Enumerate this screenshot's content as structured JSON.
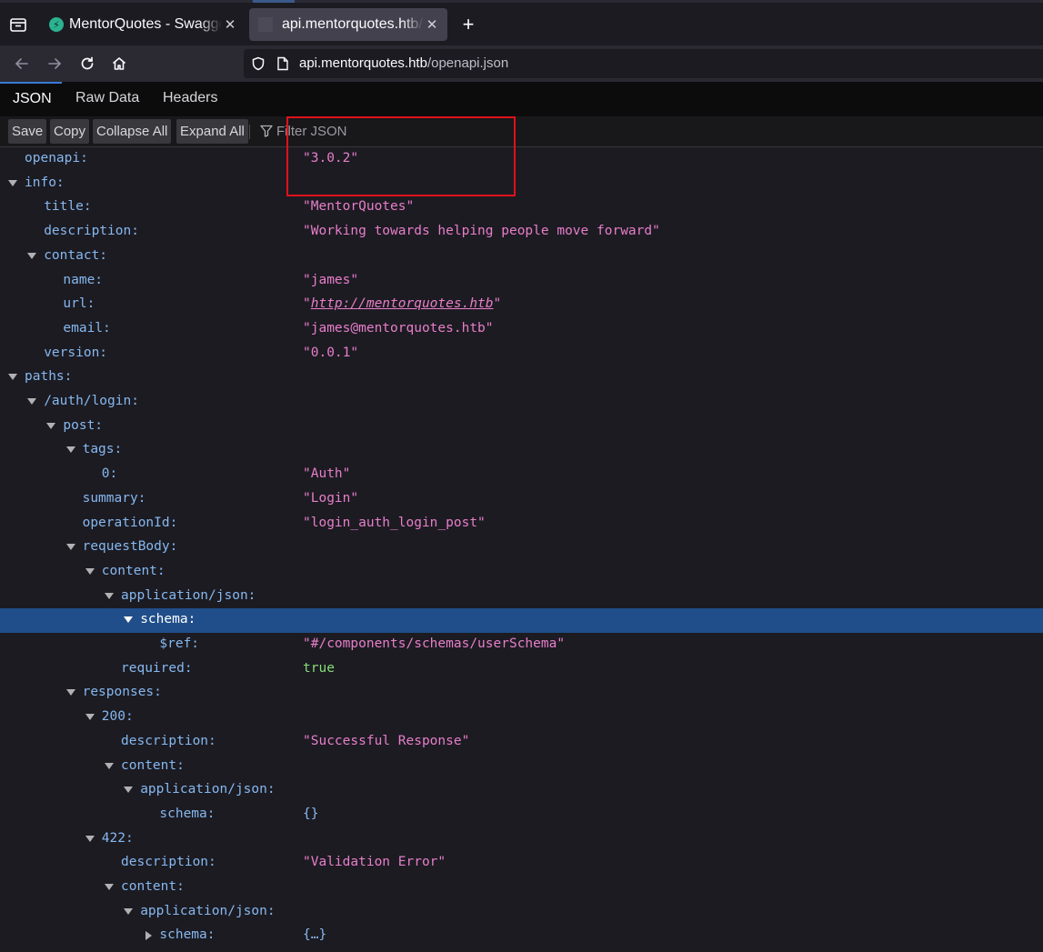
{
  "browser": {
    "tabs": [
      {
        "title": "MentorQuotes - Swagger UI",
        "active": false
      },
      {
        "title": "api.mentorquotes.htb/openapi.json",
        "active": true
      }
    ],
    "url_host": "api.mentorquotes.htb",
    "url_path": "/openapi.json"
  },
  "viewer": {
    "tabs": [
      "JSON",
      "Raw Data",
      "Headers"
    ],
    "toolbar": {
      "save": "Save",
      "copy": "Copy",
      "collapse_all": "Collapse All",
      "expand_all": "Expand All",
      "filter_placeholder": "Filter JSON"
    }
  },
  "tree": [
    {
      "key": "openapi:",
      "value": "\"3.0.2\"",
      "type": "str"
    },
    {
      "key": "info:",
      "toggle": "open"
    },
    {
      "key": "title:",
      "value": "\"MentorQuotes\"",
      "type": "str"
    },
    {
      "key": "description:",
      "value": "\"Working towards helping people move forward\"",
      "type": "str"
    },
    {
      "key": "contact:",
      "toggle": "open"
    },
    {
      "key": "name:",
      "value": "\"james\"",
      "type": "str"
    },
    {
      "key": "url:",
      "value": "http://mentorquotes.htb",
      "type": "link"
    },
    {
      "key": "email:",
      "value": "\"james@mentorquotes.htb\"",
      "type": "str"
    },
    {
      "key": "version:",
      "value": "\"0.0.1\"",
      "type": "str"
    },
    {
      "key": "paths:",
      "toggle": "open"
    },
    {
      "key": "/auth/login:",
      "toggle": "open"
    },
    {
      "key": "post:",
      "toggle": "open"
    },
    {
      "key": "tags:",
      "toggle": "open"
    },
    {
      "key": "0:",
      "value": "\"Auth\"",
      "type": "str"
    },
    {
      "key": "summary:",
      "value": "\"Login\"",
      "type": "str"
    },
    {
      "key": "operationId:",
      "value": "\"login_auth_login_post\"",
      "type": "str"
    },
    {
      "key": "requestBody:",
      "toggle": "open"
    },
    {
      "key": "content:",
      "toggle": "open"
    },
    {
      "key": "application/json:",
      "toggle": "open"
    },
    {
      "key": "schema:",
      "toggle": "open",
      "selected": true
    },
    {
      "key": "$ref:",
      "value": "\"#/components/schemas/userSchema\"",
      "type": "str"
    },
    {
      "key": "required:",
      "value": "true",
      "type": "bool"
    },
    {
      "key": "responses:",
      "toggle": "open"
    },
    {
      "key": "200:",
      "toggle": "open"
    },
    {
      "key": "description:",
      "value": "\"Successful Response\"",
      "type": "str"
    },
    {
      "key": "content:",
      "toggle": "open"
    },
    {
      "key": "application/json:",
      "toggle": "open"
    },
    {
      "key": "schema:",
      "value": "{}",
      "type": "obj"
    },
    {
      "key": "422:",
      "toggle": "open"
    },
    {
      "key": "description:",
      "value": "\"Validation Error\"",
      "type": "str"
    },
    {
      "key": "content:",
      "toggle": "open"
    },
    {
      "key": "application/json:",
      "toggle": "open"
    },
    {
      "key": "schema:",
      "value": "{…}",
      "type": "obj",
      "toggle": "closed"
    }
  ]
}
